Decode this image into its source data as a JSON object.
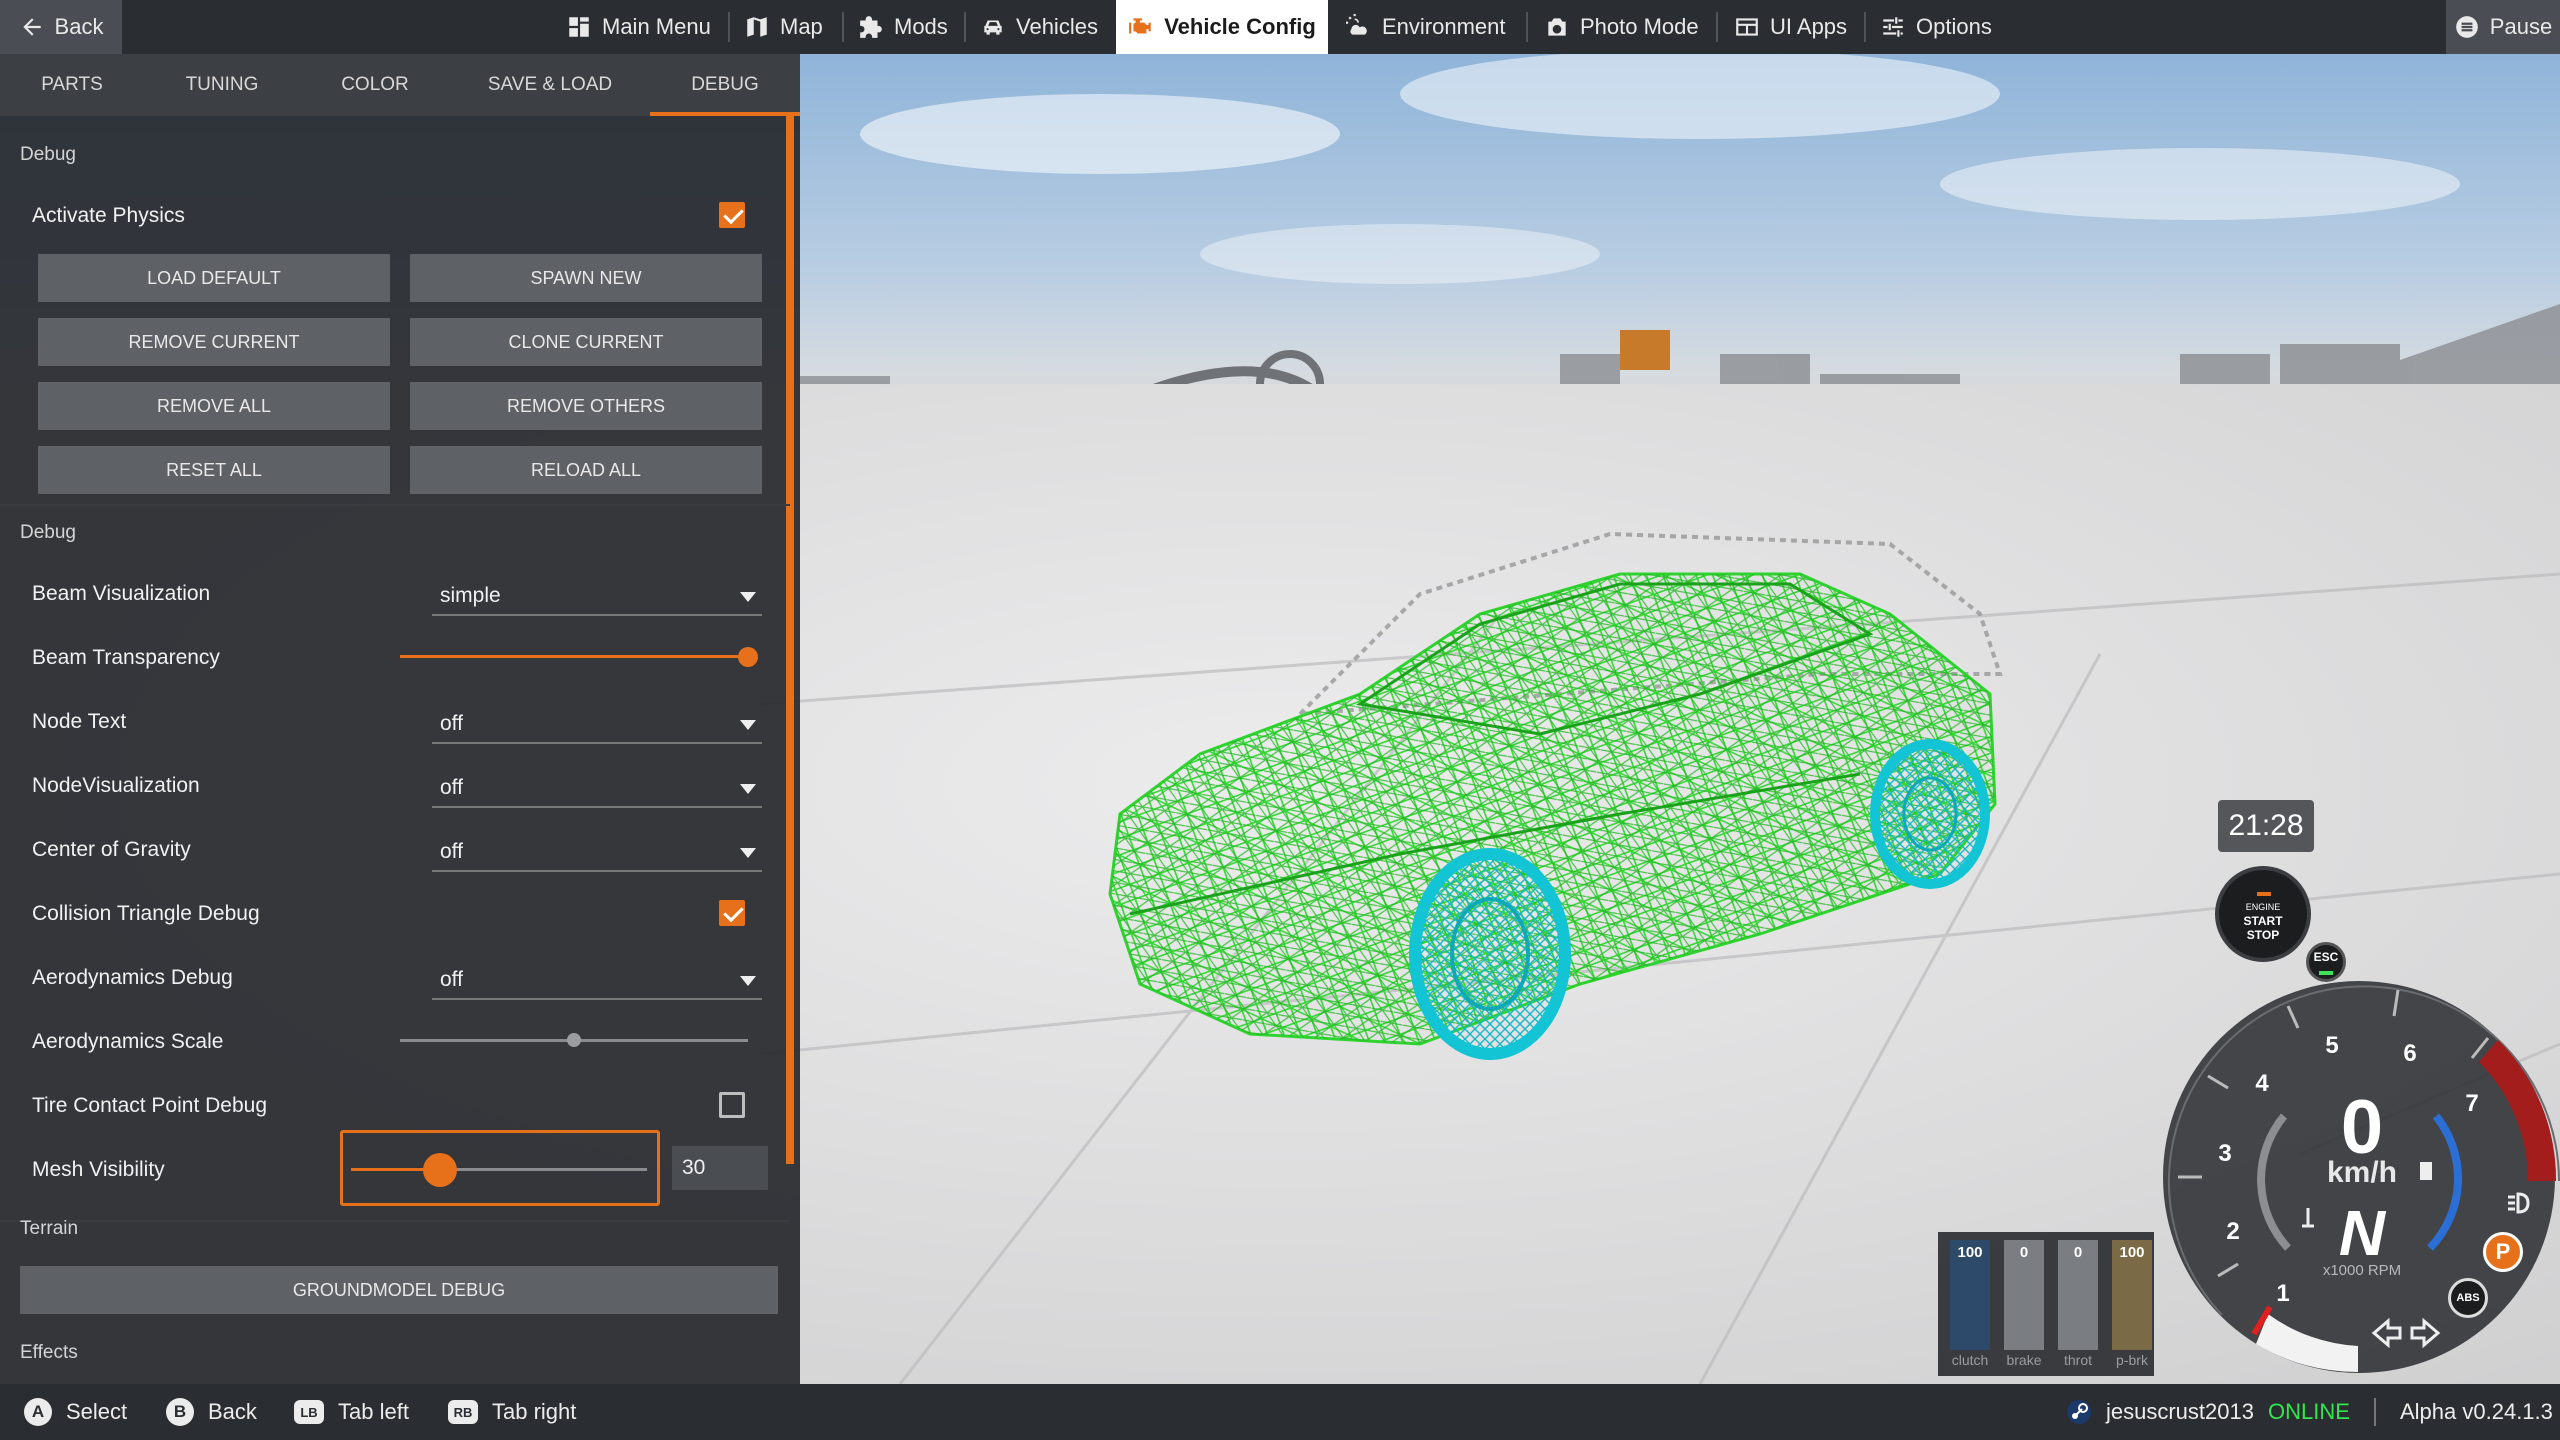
{
  "topbar": {
    "back": "Back",
    "items": [
      "Main Menu",
      "Map",
      "Mods",
      "Vehicles",
      "Vehicle Config",
      "Environment",
      "Photo Mode",
      "UI Apps",
      "Options"
    ],
    "pause": "Pause",
    "active_index": 4,
    "accent": "#e7711b"
  },
  "tabs": [
    "PARTS",
    "TUNING",
    "COLOR",
    "SAVE & LOAD",
    "DEBUG"
  ],
  "active_tab": "DEBUG",
  "debug_section": {
    "title": "Debug",
    "activate_physics_label": "Activate Physics",
    "activate_physics_checked": true,
    "buttons": [
      "LOAD DEFAULT",
      "SPAWN NEW",
      "REMOVE CURRENT",
      "CLONE CURRENT",
      "REMOVE ALL",
      "REMOVE OTHERS",
      "RESET ALL",
      "RELOAD ALL"
    ]
  },
  "debug_options": {
    "title": "Debug",
    "beam_visualization": {
      "label": "Beam Visualization",
      "value": "simple"
    },
    "beam_transparency": {
      "label": "Beam Transparency",
      "level": 1.0
    },
    "node_text": {
      "label": "Node Text",
      "value": "off"
    },
    "node_visualization": {
      "label": "NodeVisualization",
      "value": "off"
    },
    "center_of_gravity": {
      "label": "Center of Gravity",
      "value": "off"
    },
    "collision_triangle_debug": {
      "label": "Collision Triangle Debug",
      "checked": true
    },
    "aerodynamics_debug": {
      "label": "Aerodynamics Debug",
      "value": "off"
    },
    "aerodynamics_scale": {
      "label": "Aerodynamics Scale",
      "level": 0.5
    },
    "tire_contact_point_debug": {
      "label": "Tire Contact Point Debug",
      "checked": false
    },
    "mesh_visibility": {
      "label": "Mesh Visibility",
      "value": "30",
      "level": 0.3
    }
  },
  "terrain": {
    "title": "Terrain",
    "button": "GROUNDMODEL DEBUG"
  },
  "effects": {
    "title": "Effects"
  },
  "bottombar": {
    "hints": [
      {
        "glyph": "A",
        "label": "Select"
      },
      {
        "glyph": "B",
        "label": "Back"
      },
      {
        "glyph": "LB",
        "label": "Tab left"
      },
      {
        "glyph": "RB",
        "label": "Tab right"
      }
    ],
    "username": "jesuscrust2013",
    "status": "ONLINE",
    "version": "Alpha v0.24.1.3"
  },
  "hud": {
    "clock": "21:28",
    "start_stop": [
      "ENGINE",
      "START",
      "STOP"
    ],
    "esc": "ESC",
    "abs": "ABS",
    "parking": "P",
    "speed": "0",
    "speed_unit": "km/h",
    "gear": "N",
    "rpm_unit": "x1000 RPM",
    "rpm_ticks": [
      "1",
      "2",
      "3",
      "4",
      "5",
      "6",
      "7"
    ],
    "pedals": [
      {
        "label": "clutch",
        "value": "100",
        "level": 1.0,
        "color": "#2e4a6b"
      },
      {
        "label": "brake",
        "value": "0",
        "level": 0.0,
        "color": "#7a3535"
      },
      {
        "label": "throt",
        "value": "0",
        "level": 0.0,
        "color": "#3a6b3a"
      },
      {
        "label": "p-brk",
        "value": "100",
        "level": 1.0,
        "color": "#7a6a45"
      }
    ]
  }
}
